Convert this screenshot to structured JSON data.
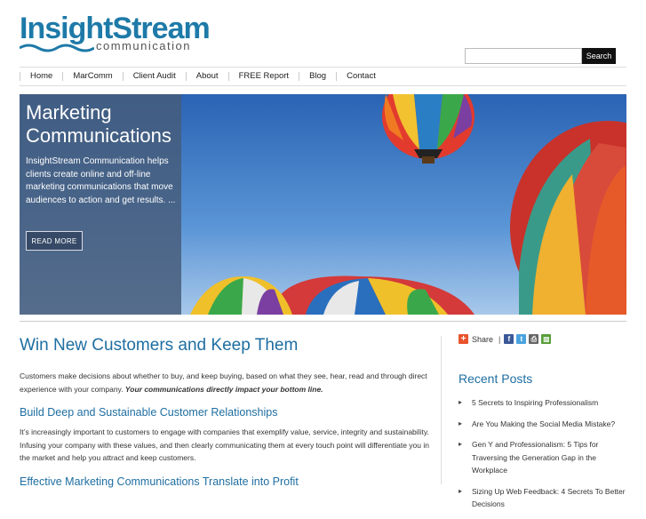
{
  "logo": {
    "main": "InsightStream",
    "sub": "communication"
  },
  "search": {
    "placeholder": "",
    "button_label": "Search"
  },
  "nav": {
    "items": [
      {
        "label": "Home"
      },
      {
        "label": "MarComm"
      },
      {
        "label": "Client Audit"
      },
      {
        "label": "About"
      },
      {
        "label": "FREE Report"
      },
      {
        "label": "Blog"
      },
      {
        "label": "Contact"
      }
    ]
  },
  "hero": {
    "title": "Marketing Communications",
    "text": "InsightStream Communication helps clients create online and off-line marketing communications that move audiences to action and get results. ...",
    "button_label": "READ MORE"
  },
  "main": {
    "title": "Win New Customers and Keep Them",
    "p1": "Customers make decisions about whether to buy, and keep buying, based on what they see, hear, read and through direct experience with your company.",
    "p1_em": "Your communications directly impact your bottom line.",
    "h2a": "Build Deep and Sustainable Customer Relationships",
    "p2": "It’s increasingly important to customers to engage with companies that exemplify value, service, integrity and sustainability. Infusing your company with these values, and then clearly communicating them at every touch point will differentiate you in the market and help you attract and keep customers.",
    "h2b": "Effective Marketing Communications Translate into Profit"
  },
  "sidebar": {
    "share_label": "Share",
    "share_sep": "|",
    "recent_title": "Recent Posts",
    "recent": [
      {
        "label": "5 Secrets to Inspiring Professionalism"
      },
      {
        "label": "Are You Making the Social Media Mistake?"
      },
      {
        "label": "Gen Y and Professionalism: 5 Tips for Traversing the Generation Gap in the Workplace"
      },
      {
        "label": "Sizing Up Web Feedback: 4 Secrets To Better Decisions"
      }
    ]
  },
  "colors": {
    "brand": "#1e7aa8",
    "heading": "#1e6ea1",
    "hero_panel": "#465a78"
  },
  "icons": [
    "wave-icon",
    "share-plus-icon",
    "facebook-icon",
    "twitter-icon",
    "print-icon",
    "delicious-icon",
    "bullet-arrow-icon"
  ]
}
